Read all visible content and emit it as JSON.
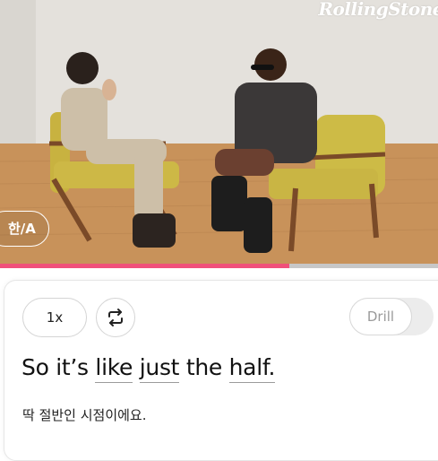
{
  "video": {
    "watermark": "RollingStone",
    "subtitle_language_label": "한/A",
    "progress_fraction": 0.66
  },
  "controls": {
    "speed_label": "1x",
    "repeat_icon": "repeat-icon",
    "drill_label": "Drill",
    "drill_enabled": false
  },
  "sentence": {
    "words": [
      "So",
      "it’s",
      "like",
      "just",
      "the",
      "half."
    ],
    "underlined_words": [
      "like",
      "just",
      "half."
    ]
  },
  "translation": "딱 절반인 시점이에요.",
  "colors": {
    "progress": "#f0507a",
    "track": "#c7c7c7",
    "button_border": "#d4d4d4"
  }
}
